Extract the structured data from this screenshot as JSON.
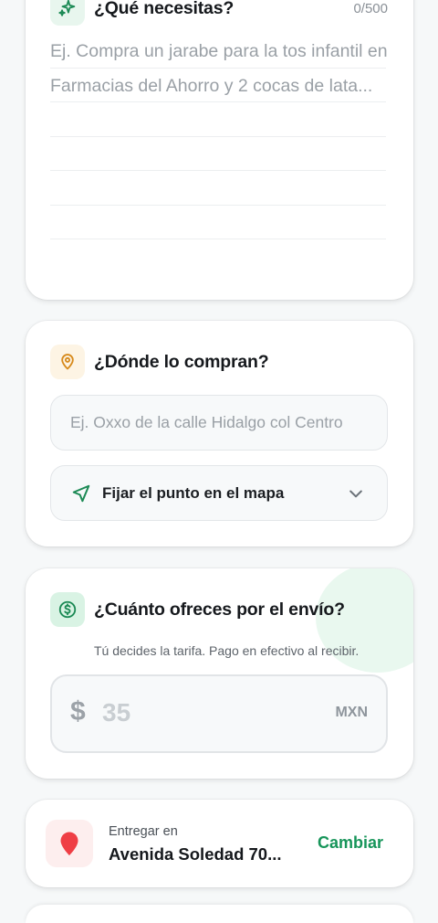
{
  "need": {
    "title": "¿Qué necesitas?",
    "counter": "0/500",
    "placeholder": "Ej. Compra un jarabe para la tos infantil en Farmacias del Ahorro y 2 cocas de lata...",
    "icon": "sparkle-icon"
  },
  "where": {
    "title": "¿Dónde lo compran?",
    "placeholder": "Ej. Oxxo de la calle Hidalgo col Centro",
    "map_button_label": "Fijar el punto en el mapa",
    "icon": "location-pin-icon"
  },
  "price": {
    "title": "¿Cuánto ofreces por el envío?",
    "subtitle": "Tú decides la tarifa. Pago en efectivo al recibir.",
    "currency_symbol": "$",
    "placeholder": "35",
    "currency": "MXN",
    "icon": "dollar-coin-icon"
  },
  "delivery": {
    "label": "Entregar en",
    "address": "Avenida Soledad 70...",
    "change_label": "Cambiar",
    "icon": "map-marker-icon"
  },
  "colors": {
    "accent_green": "#17955a",
    "icon_green_bg": "#e8f6ee",
    "icon_orange_bg": "#fdf4e4",
    "pin_orange": "#d78a1c",
    "marker_red": "#ef3e45",
    "marker_red_bg": "#fdeeee"
  }
}
